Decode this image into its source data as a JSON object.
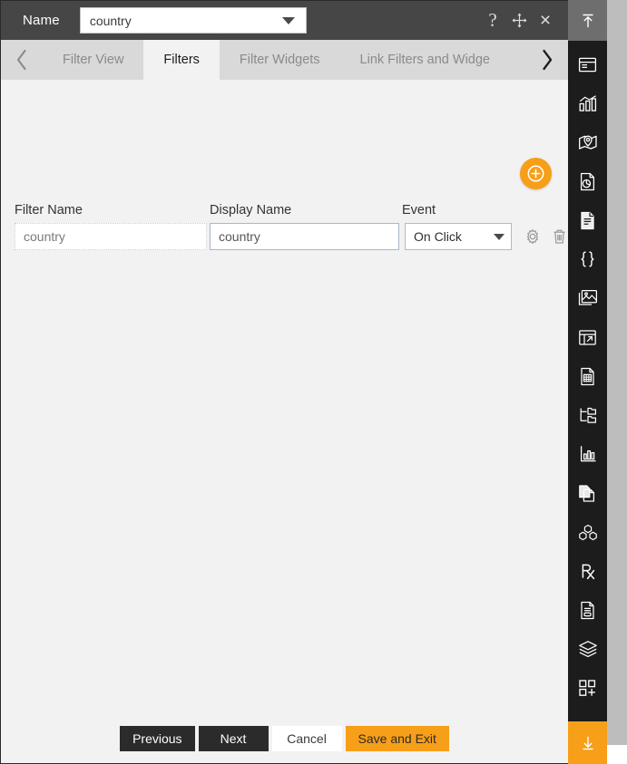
{
  "titlebar": {
    "label": "Name",
    "name_value": "country",
    "controls": [
      {
        "name": "help-icon",
        "glyph": "?"
      },
      {
        "name": "move-icon",
        "glyph": "move"
      },
      {
        "name": "close-icon",
        "glyph": "×"
      }
    ]
  },
  "tabs": {
    "prev_label": "‹",
    "next_label": "›",
    "items": [
      {
        "label": "Filter View",
        "active": false
      },
      {
        "label": "Filters",
        "active": true
      },
      {
        "label": "Filter Widgets",
        "active": false
      },
      {
        "label": "Link Filters and Widge",
        "active": false
      }
    ]
  },
  "toolbar": {
    "add_title": "Add"
  },
  "form": {
    "headers": {
      "filter_name": "Filter Name",
      "display_name": "Display Name",
      "event": "Event"
    },
    "rows": [
      {
        "filter_name": "country",
        "display_name": "country",
        "event": "On Click",
        "settings_icon": "gear-icon",
        "delete_icon": "trash-icon"
      }
    ],
    "event_options": [
      "On Click"
    ]
  },
  "footer": {
    "previous": "Previous",
    "next": "Next",
    "cancel": "Cancel",
    "save_and_exit": "Save and Exit"
  },
  "rail": {
    "top": {
      "name": "collapse-up-icon"
    },
    "bottom": {
      "name": "expand-down-icon"
    },
    "items": [
      {
        "name": "window-panel-icon"
      },
      {
        "name": "bar-chart-icon"
      },
      {
        "name": "map-pin-icon"
      },
      {
        "name": "pie-document-icon"
      },
      {
        "name": "text-document-icon"
      },
      {
        "name": "curly-braces-icon"
      },
      {
        "name": "image-stack-icon"
      },
      {
        "name": "dashboard-link-icon"
      },
      {
        "name": "spreadsheet-document-icon"
      },
      {
        "name": "tree-folders-icon"
      },
      {
        "name": "column-chart-icon"
      },
      {
        "name": "copy-pages-icon"
      },
      {
        "name": "cubes-icon"
      },
      {
        "name": "prescription-rx-icon"
      },
      {
        "name": "script-document-icon"
      },
      {
        "name": "layers-icon"
      },
      {
        "name": "add-tile-icon"
      }
    ]
  },
  "colors": {
    "accent_orange": "#f79f19",
    "titlebar_gray": "#464646",
    "tabstrip_gray": "#d9d9d9",
    "body_gray": "#f2f2f2",
    "rail_black": "#1c1c1c",
    "dark_button": "#2b2b2b"
  }
}
